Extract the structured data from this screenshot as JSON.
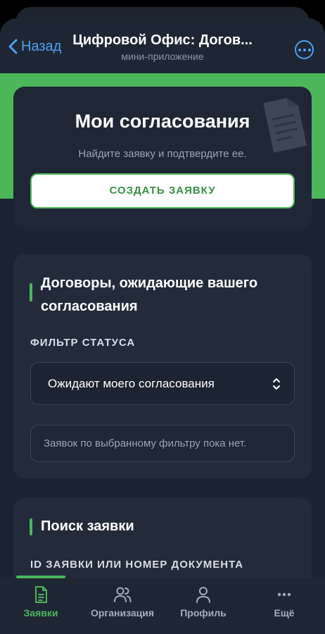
{
  "header": {
    "back_label": "Назад",
    "title": "Цифровой Офис: Догов...",
    "subtitle": "мини-приложение",
    "more_icon": "more-dots-icon"
  },
  "hero": {
    "title": "Мои согласования",
    "subtitle": "Найдите заявку и подтвердите ее.",
    "create_button": "СОЗДАТЬ ЗАЯВКУ"
  },
  "approvals": {
    "title": "Договоры, ожидающие вашего согласования",
    "filter_label": "ФИЛЬТР СТАТУСА",
    "filter_value": "Ожидают моего согласования",
    "empty_text": "Заявок по выбранному фильтру пока нет."
  },
  "search": {
    "title": "Поиск заявки",
    "id_label": "ID ЗАЯВКИ ИЛИ НОМЕР ДОКУМЕНТА"
  },
  "tabs": [
    {
      "label": "Заявки",
      "icon": "document-icon",
      "active": true
    },
    {
      "label": "Организация",
      "icon": "users-icon",
      "active": false
    },
    {
      "label": "Профиль",
      "icon": "user-icon",
      "active": false
    },
    {
      "label": "Ещё",
      "icon": "more-dots-icon",
      "active": false
    }
  ],
  "colors": {
    "accent": "#4cb65a",
    "link": "#4ea0f5",
    "background": "#1b2230",
    "card": "#232b3a"
  }
}
